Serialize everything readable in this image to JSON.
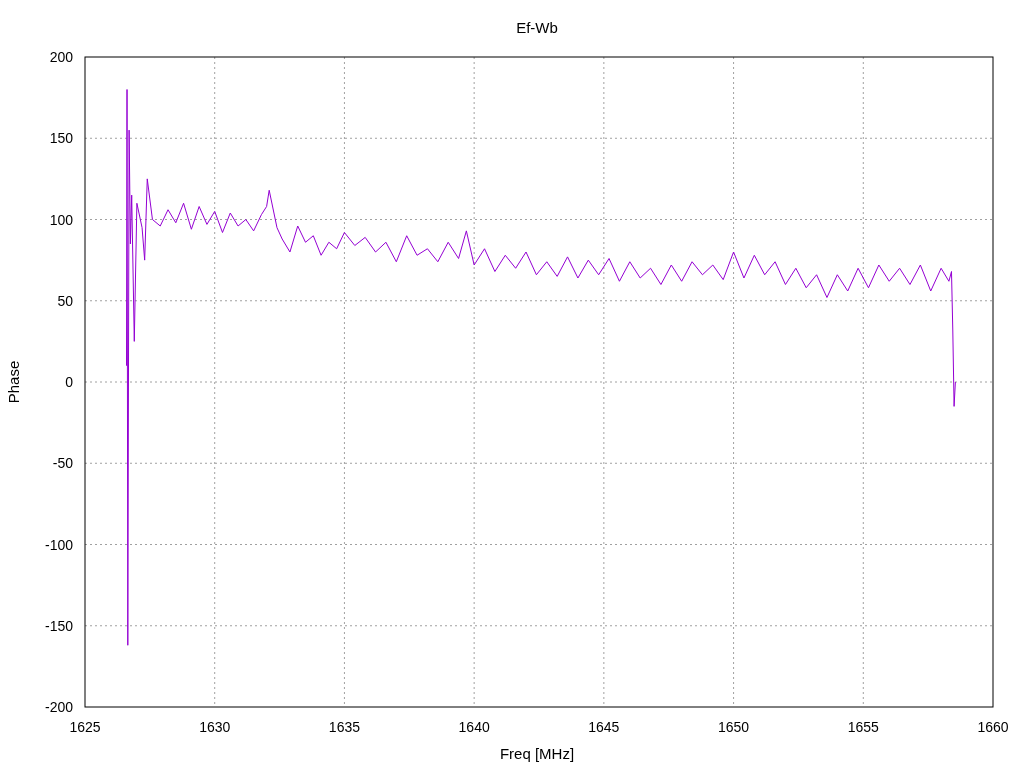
{
  "chart_data": {
    "type": "line",
    "title": "Ef-Wb",
    "xlabel": "Freq [MHz]",
    "ylabel": "Phase",
    "x": [
      1626.6,
      1626.62,
      1626.65,
      1626.7,
      1626.75,
      1626.8,
      1626.9,
      1627.0,
      1627.2,
      1627.3,
      1627.4,
      1627.6,
      1627.9,
      1628.2,
      1628.5,
      1628.8,
      1629.1,
      1629.4,
      1629.7,
      1630.0,
      1630.3,
      1630.6,
      1630.9,
      1631.2,
      1631.5,
      1631.8,
      1632.0,
      1632.1,
      1632.4,
      1632.6,
      1632.9,
      1633.2,
      1633.5,
      1633.8,
      1634.1,
      1634.4,
      1634.7,
      1635.0,
      1635.4,
      1635.8,
      1636.2,
      1636.6,
      1637.0,
      1637.4,
      1637.8,
      1638.2,
      1638.6,
      1639.0,
      1639.4,
      1639.7,
      1640.0,
      1640.4,
      1640.8,
      1641.2,
      1641.6,
      1642.0,
      1642.4,
      1642.8,
      1643.2,
      1643.6,
      1644.0,
      1644.4,
      1644.8,
      1645.2,
      1645.6,
      1646.0,
      1646.4,
      1646.8,
      1647.2,
      1647.6,
      1648.0,
      1648.4,
      1648.8,
      1649.2,
      1649.6,
      1650.0,
      1650.4,
      1650.8,
      1651.2,
      1651.6,
      1652.0,
      1652.4,
      1652.8,
      1653.2,
      1653.6,
      1654.0,
      1654.4,
      1654.8,
      1655.2,
      1655.6,
      1656.0,
      1656.4,
      1656.8,
      1657.2,
      1657.6,
      1658.0,
      1658.3,
      1658.4,
      1658.45,
      1658.5,
      1658.55
    ],
    "series": [
      {
        "color": "#9400d3",
        "values": [
          10,
          180,
          -162,
          155,
          85,
          115,
          25,
          110,
          95,
          75,
          125,
          100,
          96,
          106,
          98,
          110,
          94,
          108,
          97,
          105,
          92,
          104,
          96,
          100,
          93,
          103,
          108,
          118,
          95,
          88,
          80,
          96,
          86,
          90,
          78,
          86,
          82,
          92,
          84,
          89,
          80,
          86,
          74,
          90,
          78,
          82,
          74,
          86,
          76,
          93,
          72,
          82,
          68,
          78,
          70,
          80,
          66,
          74,
          65,
          77,
          64,
          75,
          66,
          76,
          62,
          74,
          64,
          70,
          60,
          72,
          62,
          74,
          66,
          72,
          63,
          80,
          64,
          78,
          66,
          74,
          60,
          70,
          58,
          66,
          52,
          66,
          56,
          70,
          58,
          72,
          62,
          70,
          60,
          72,
          56,
          70,
          62,
          68,
          32,
          -15,
          0
        ]
      }
    ],
    "grid": true,
    "xlim": [
      1625,
      1660
    ],
    "ylim": [
      -200,
      200
    ],
    "xticks": [
      1625,
      1630,
      1635,
      1640,
      1645,
      1650,
      1655,
      1660
    ],
    "yticks": [
      -200,
      -150,
      -100,
      -50,
      0,
      50,
      100,
      150,
      200
    ]
  }
}
